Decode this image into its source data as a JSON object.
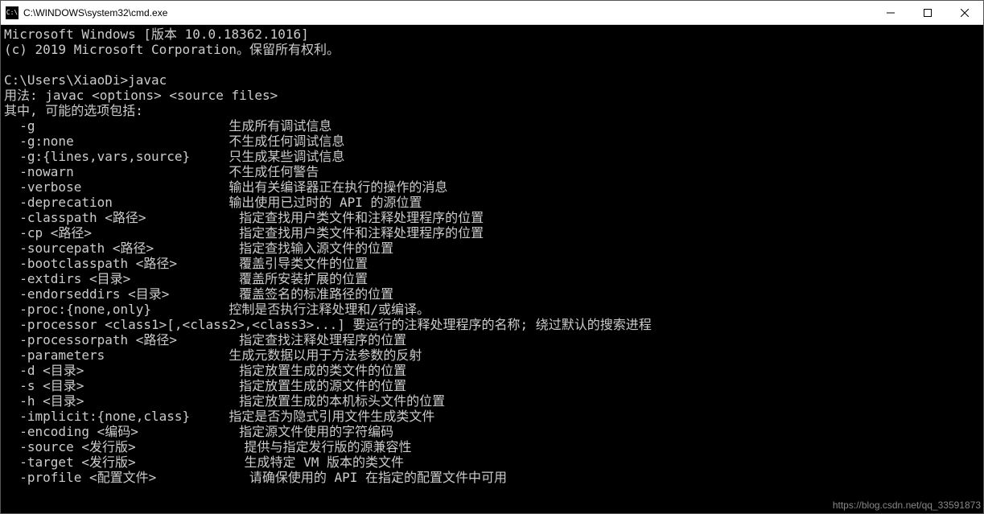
{
  "window": {
    "title": "C:\\WINDOWS\\system32\\cmd.exe",
    "icon_label": "C:\\"
  },
  "terminal": {
    "header1": "Microsoft Windows [版本 10.0.18362.1016]",
    "header2": "(c) 2019 Microsoft Corporation。保留所有权利。",
    "blank": "",
    "prompt": "C:\\Users\\XiaoDi>javac",
    "usage": "用法: javac <options> <source files>",
    "where": "其中, 可能的选项包括:",
    "opts": [
      "  -g                         生成所有调试信息",
      "  -g:none                    不生成任何调试信息",
      "  -g:{lines,vars,source}     只生成某些调试信息",
      "  -nowarn                    不生成任何警告",
      "  -verbose                   输出有关编译器正在执行的操作的消息",
      "  -deprecation               输出使用已过时的 API 的源位置",
      "  -classpath <路径>            指定查找用户类文件和注释处理程序的位置",
      "  -cp <路径>                   指定查找用户类文件和注释处理程序的位置",
      "  -sourcepath <路径>           指定查找输入源文件的位置",
      "  -bootclasspath <路径>        覆盖引导类文件的位置",
      "  -extdirs <目录>              覆盖所安装扩展的位置",
      "  -endorseddirs <目录>         覆盖签名的标准路径的位置",
      "  -proc:{none,only}          控制是否执行注释处理和/或编译。",
      "  -processor <class1>[,<class2>,<class3>...] 要运行的注释处理程序的名称; 绕过默认的搜索进程",
      "  -processorpath <路径>        指定查找注释处理程序的位置",
      "  -parameters                生成元数据以用于方法参数的反射",
      "  -d <目录>                    指定放置生成的类文件的位置",
      "  -s <目录>                    指定放置生成的源文件的位置",
      "  -h <目录>                    指定放置生成的本机标头文件的位置",
      "  -implicit:{none,class}     指定是否为隐式引用文件生成类文件",
      "  -encoding <编码>             指定源文件使用的字符编码",
      "  -source <发行版>              提供与指定发行版的源兼容性",
      "  -target <发行版>              生成特定 VM 版本的类文件",
      "  -profile <配置文件>            请确保使用的 API 在指定的配置文件中可用"
    ]
  },
  "watermark": "https://blog.csdn.net/qq_33591873"
}
